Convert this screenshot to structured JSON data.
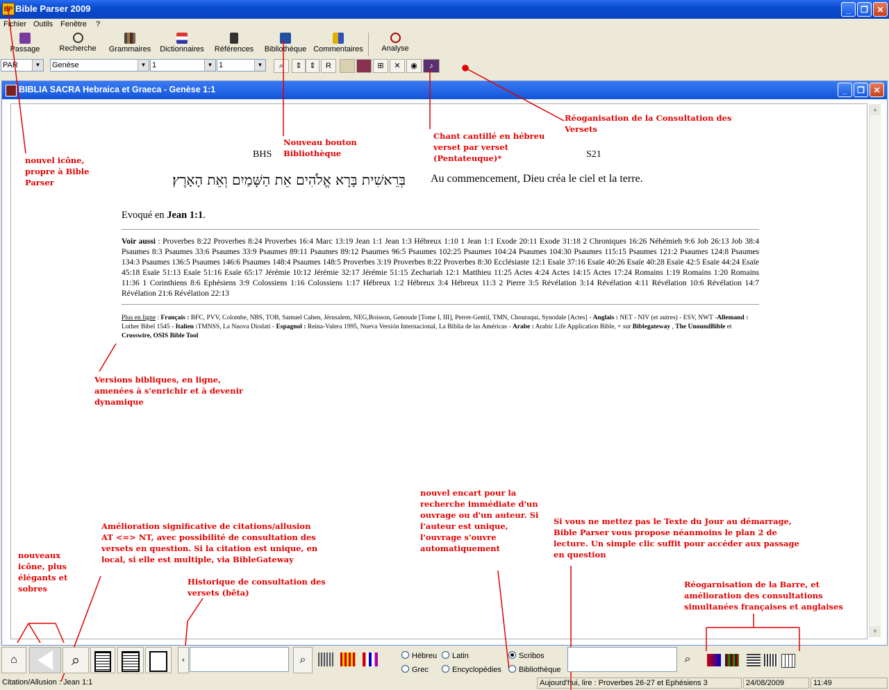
{
  "app": {
    "title": "Bible Parser 2009",
    "icon_text": "BP"
  },
  "menu": [
    "Fichier",
    "Outils",
    "Fenêtre",
    "?"
  ],
  "toolbar": [
    {
      "label": "Passage",
      "icon": "book-icon"
    },
    {
      "label": "Recherche",
      "icon": "magnifier-icon"
    },
    {
      "label": "Grammaires",
      "icon": "books-icon"
    },
    {
      "label": "Dictionnaires",
      "icon": "dictionary-icon"
    },
    {
      "label": "Références",
      "icon": "references-icon"
    },
    {
      "label": "Bibliothèque",
      "icon": "library-icon"
    },
    {
      "label": "Commentaires",
      "icon": "commentary-icon"
    },
    {
      "label": "Analyse",
      "icon": "analysis-icon"
    }
  ],
  "selectors": {
    "version": "PAR",
    "book": "Genèse",
    "chapter": "1",
    "verse": "1",
    "r_label": "R"
  },
  "document": {
    "window_title": "BIBLIA SACRA Hebraica et Graeca - Genèse 1:1",
    "left_label": "BHS",
    "right_label": "S21",
    "hebrew_text": "בְּרֵאשִׁית בָּרָא אֱלֹהִים אֵת הַשָּׁמַיִם וְאֵת הָאָרֶץ׃",
    "french_text": "Au commencement, Dieu créa le ciel et la terre.",
    "evoque_prefix": "Evoqué en ",
    "evoque_ref": "Jean 1:1",
    "evoque_suffix": ".",
    "voir_label": "Voir aussi",
    "voir_text": " : Proverbes 8:22 Proverbes 8:24 Proverbes 16:4 Marc 13:19 Jean 1:1 Jean 1:3 Hébreux 1:10 1 Jean 1:1 Exode 20:11 Exode 31:18 2 Chroniques 16:26 Néhémieh 9:6 Job 26:13 Job 38:4 Psaumes 8:3 Psaumes 33:6 Psaumes 33:9 Psaumes 89:11 Psaumes 89:12 Psaumes 96:5 Psaumes 102:25 Psaumes 104:24 Psaumes 104:30 Psaumes 115:15 Psaumes 121:2 Psaumes 124:8 Psaumes 134:3 Psaumes 136:5 Psaumes 146:6 Psaumes 148:4 Psaumes 148:5 Proverbes 3:19 Proverbes 8:22 Proverbes 8:30 Ecclésiaste 12:1 Esaïe 37:16 Esaïe 40:26 Esaïe 40:28 Esaïe 42:5 Esaïe 44:24 Esaïe 45:18 Esaïe 51:13 Esaïe 51:16 Esaïe 65:17 Jérémie 10:12 Jérémie 32:17 Jérémie 51:15 Zechariah 12:1 Matthieu 11:25 Actes 4:24 Actes 14:15 Actes 17:24 Romains 1:19 Romains 1:20 Romains 11:36 1 Corinthiens 8:6 Ephésiens 3:9 Colossiens 1:16 Colossiens 1:17 Hébreux 1:2 Hébreux 3:4 Hébreux 11:3 2 Pierre 3:5 Révélation 3:14 Révélation 4:11 Révélation 10:6 Révélation 14:7 Révélation 21:6 Révélation 22:13",
    "online": {
      "lead": "Plus en ligne",
      "fr_label": "Français :",
      "fr_text": " BFC, PVV, Colombe, NBS, TOB, Samuel Cahen, Jérusalem, NEG,Boisson, Genoude [Tome I, III], Perret-Gentil, TMN, Chouraqui, Synodale [Actes] - ",
      "en_label": "Anglais :",
      "en_text": " NET - NIV (et autres) - ESV, NWT -",
      "de_label": "Allemand :",
      "de_text": " Luther Bibel 1545 - ",
      "it_label": "Italien :",
      "it_text": "TMNSS, La Nuova Diodati - ",
      "es_label": "Espagnol :",
      "es_text": " Reina-Valera 1995, Nueva Versión Internacional, La Biblia de las Américas - ",
      "ar_label": "Arabe :",
      "ar_text": " Arabic Life Application Bible, + sur ",
      "link1": "Biblegateway",
      "sep1": " , ",
      "link2": "The UnoundBible",
      "sep2": " et ",
      "link3": "Crosswire, OSIS Bible Tool"
    }
  },
  "annotations": {
    "icon": "nouvel icône, propre à Bible Parser",
    "bibliotheque": "Nouveau bouton Bibliothèque",
    "chant": "Chant cantillé en hébreu verset par verset (Pentateuque)*",
    "reorg": "Réoganisation de la Consultation des Versets",
    "versions": "Versions bibliques, en ligne, amenées à s'enrichir et à devenir dynamique",
    "citations": "Amélioration significative de citations/allusion AT <=> NT, avec possibilité de consultation des versets en question. Si la citation est unique, en local, si elle est multiple, via BibleGateway",
    "nouveaux": "nouveaux icône, plus élégants et sobres",
    "historique": "Historique de consultation des versets (bêta)",
    "encart": "nouvel encart pour la recherche immédiate d'un ouvrage ou d'un auteur. Si l'auteur est unique, l'ouvrage s'ouvre automatiquement",
    "texte_jour": "Si vous ne mettez pas le Texte du Jour au démarrage, Bible Parser vous propose néanmoins le plan 2 de lecture. Un simple clic suffit pour accéder aux passage en question",
    "barre": "Réogarnisation de la Barre, et amélioration des consultations simultanées françaises et anglaises"
  },
  "bottom": {
    "radios": [
      {
        "label": "Hébreu",
        "checked": false
      },
      {
        "label": "Latin",
        "checked": false
      },
      {
        "label": "Scribos",
        "checked": true
      },
      {
        "label": "Grec",
        "checked": false
      },
      {
        "label": "Encyclopédies",
        "checked": false
      },
      {
        "label": "Bibliothèque",
        "checked": false
      }
    ]
  },
  "status": {
    "citation": "Citation/Allusion : Jean 1:1",
    "daily": "Aujourd'hui, lire : Proverbes 26-27 et Ephésiens 3",
    "date": "24/08/2009",
    "time": "11:49"
  },
  "colors": {
    "titlebar": "#0a4cd0",
    "annotation": "#e00000",
    "chrome": "#ece9d8"
  }
}
